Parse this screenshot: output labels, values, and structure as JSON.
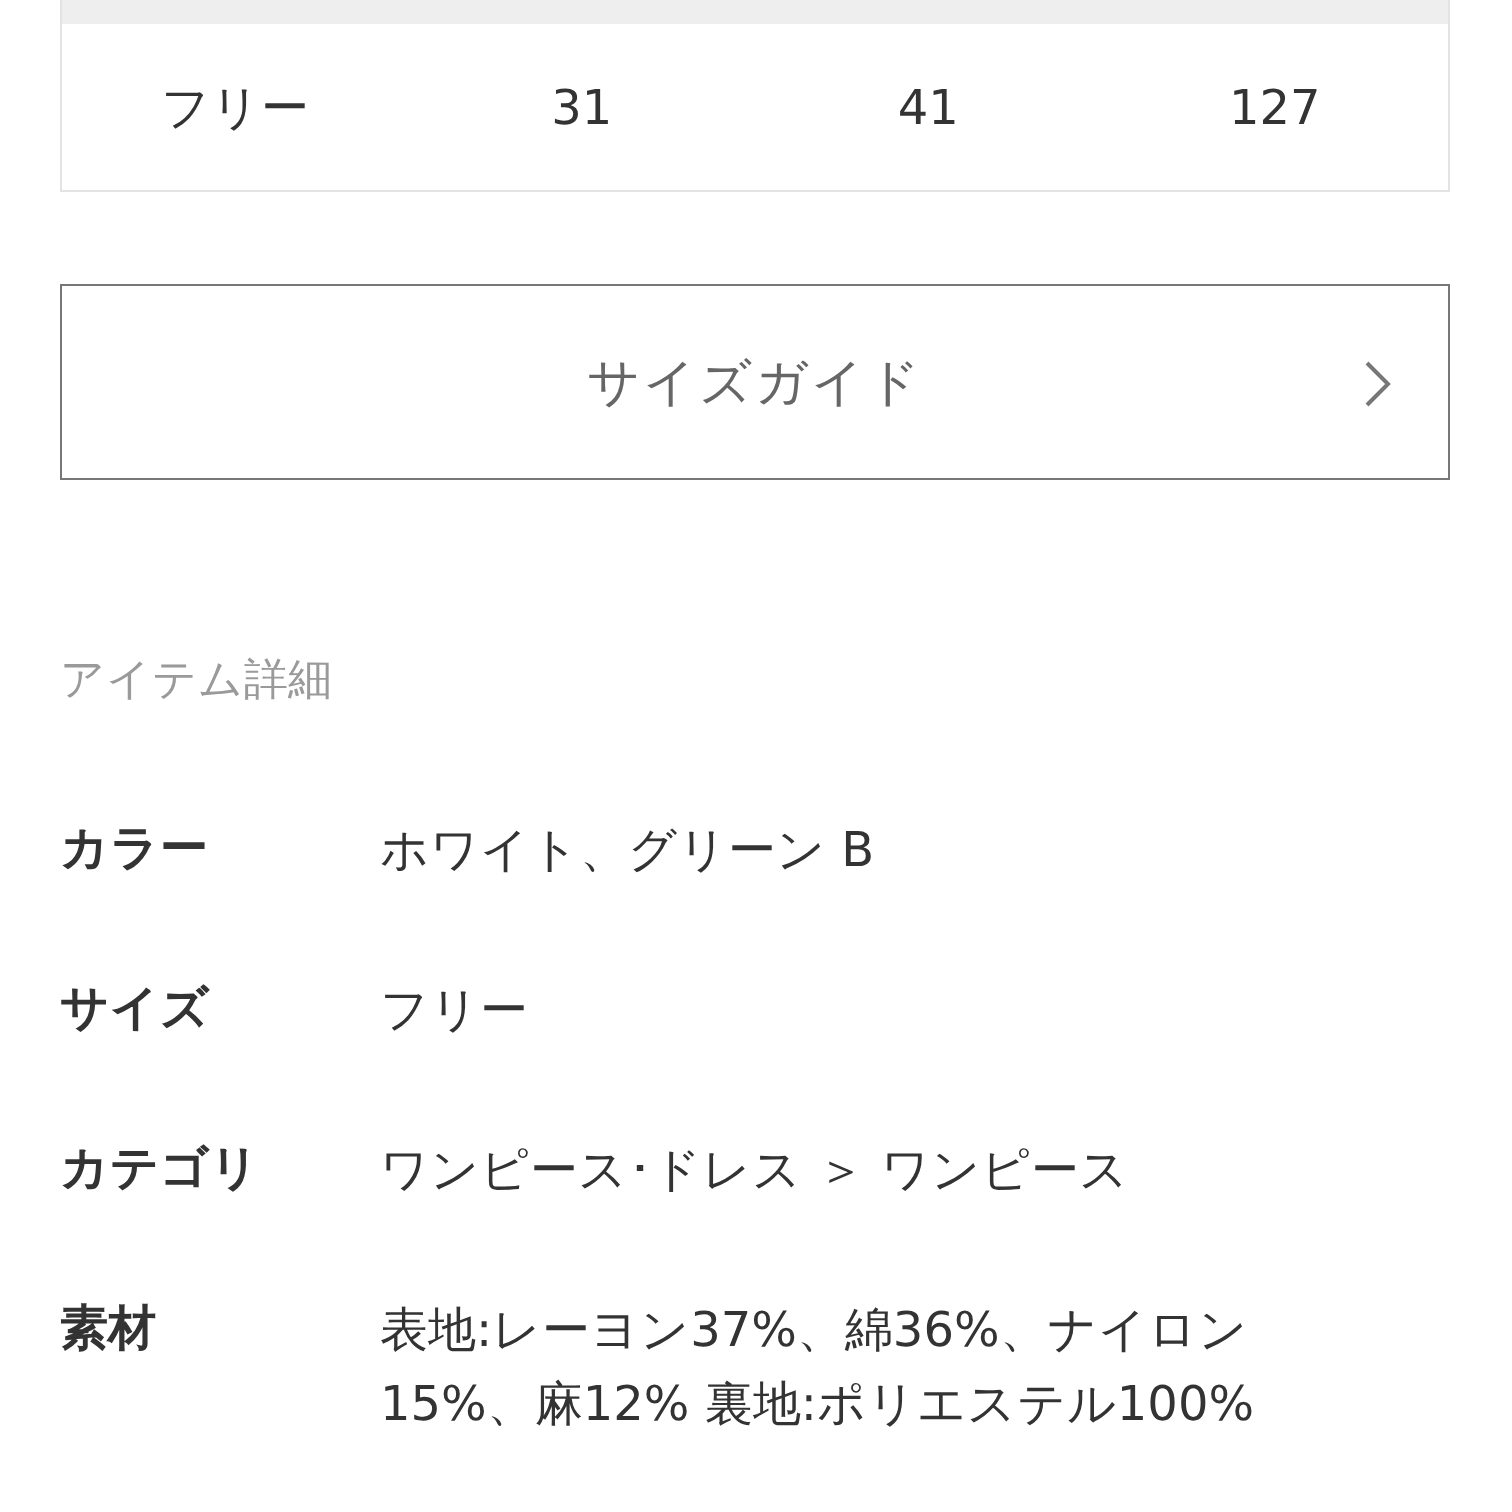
{
  "size_table": {
    "rows": [
      {
        "cells": [
          "フリー",
          "31",
          "41",
          "127"
        ]
      }
    ]
  },
  "size_guide_button": {
    "label": "サイズガイド"
  },
  "item_details": {
    "title": "アイテム詳細",
    "rows": [
      {
        "label": "カラー",
        "value": "ホワイト、グリーン B"
      },
      {
        "label": "サイズ",
        "value": "フリー"
      },
      {
        "label": "カテゴリ",
        "value": "ワンピース･ドレス ＞ ワンピース"
      },
      {
        "label": "素材",
        "value": "表地:レーヨン37%、綿36%、ナイロン15%、麻12% 裏地:ポリエステル100%"
      }
    ]
  }
}
